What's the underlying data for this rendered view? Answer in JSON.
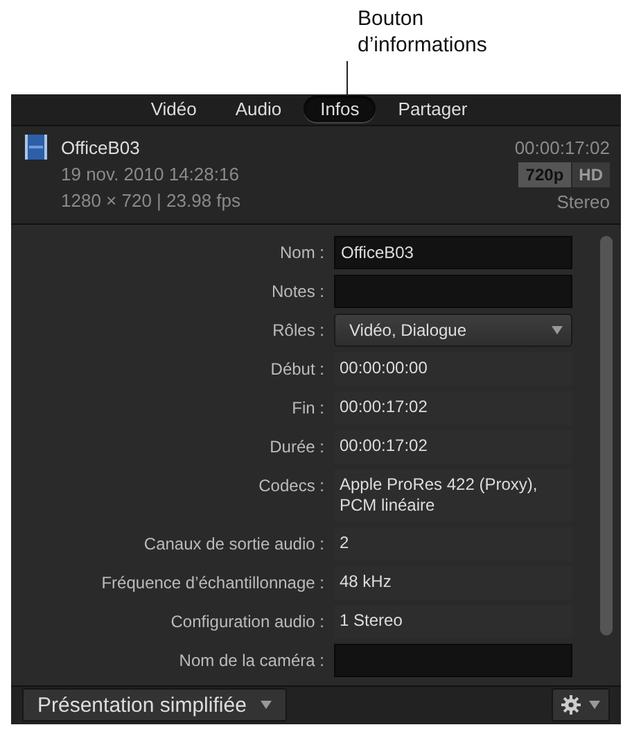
{
  "callout": {
    "text": "Bouton d’informations"
  },
  "tabs": [
    {
      "label": "Vidéo",
      "selected": false
    },
    {
      "label": "Audio",
      "selected": false
    },
    {
      "label": "Infos",
      "selected": true
    },
    {
      "label": "Partager",
      "selected": false
    }
  ],
  "clip": {
    "name": "OfficeB03",
    "duration": "00:00:17:02",
    "date": "19 nov. 2010 14:28:16",
    "format_badge": "720p",
    "hd_badge": "HD",
    "resolution": "1280 × 720 | 23.98 fps",
    "audio": "Stereo"
  },
  "fields": [
    {
      "label": "Nom :",
      "kind": "input",
      "value": "OfficeB03"
    },
    {
      "label": "Notes :",
      "kind": "input"
    },
    {
      "label": "Rôles :",
      "kind": "menu",
      "value": "Vidéo, Dialogue"
    },
    {
      "label": "Début :",
      "kind": "text",
      "value": "00:00:00:00"
    },
    {
      "label": "Fin :",
      "kind": "text",
      "value": "00:00:17:02"
    },
    {
      "label": "Durée :",
      "kind": "text",
      "value": "00:00:17:02"
    },
    {
      "label": "Codecs :",
      "kind": "text",
      "value": "Apple ProRes 422 (Proxy), PCM linéaire"
    },
    {
      "label": "Canaux de sortie audio :",
      "kind": "text",
      "value": "2"
    },
    {
      "label": "Fréquence d’échantillonnage :",
      "kind": "text",
      "value": "48 kHz"
    },
    {
      "label": "Configuration audio :",
      "kind": "text",
      "value": "1 Stereo"
    },
    {
      "label": "Nom de la caméra :",
      "kind": "input"
    }
  ],
  "footer": {
    "view_menu": "Présentation simplifiée"
  }
}
